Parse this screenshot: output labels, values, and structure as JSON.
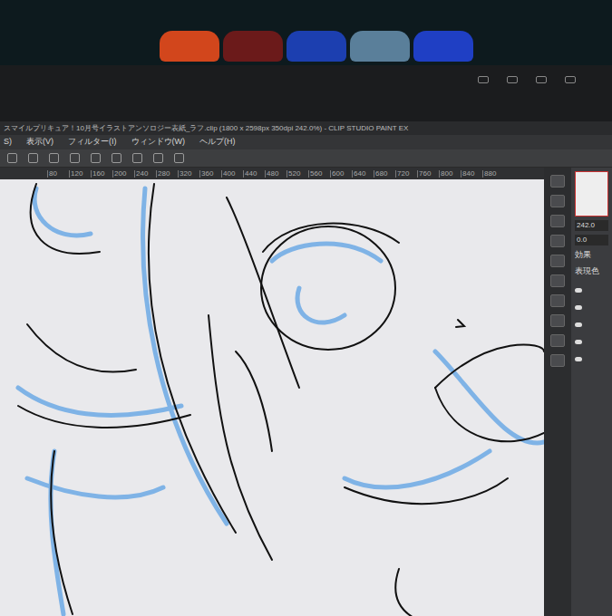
{
  "window": {
    "title": "スマイルプリキュア！10月号イラストアンソロジー表紙_ラフ.clip (1800 x 2598px 350dpi 242.0%) - CLIP STUDIO PAINT EX"
  },
  "menu": [
    "S)",
    "表示(V)",
    "フィルター(I)",
    "ウィンドウ(W)",
    "ヘルプ(H)"
  ],
  "ruler": [
    "80",
    "120",
    "160",
    "200",
    "240",
    "280",
    "320",
    "360",
    "400",
    "440",
    "480",
    "520",
    "560",
    "600",
    "640",
    "680",
    "720",
    "760",
    "800",
    "840",
    "880"
  ],
  "panel": {
    "zoom": "242.0",
    "angle": "0.0",
    "effect_label": "効果",
    "color_label": "表現色"
  },
  "layers": [
    {
      "visible": true
    },
    {
      "visible": true
    },
    {
      "visible": true
    },
    {
      "visible": true
    },
    {
      "visible": true
    }
  ]
}
